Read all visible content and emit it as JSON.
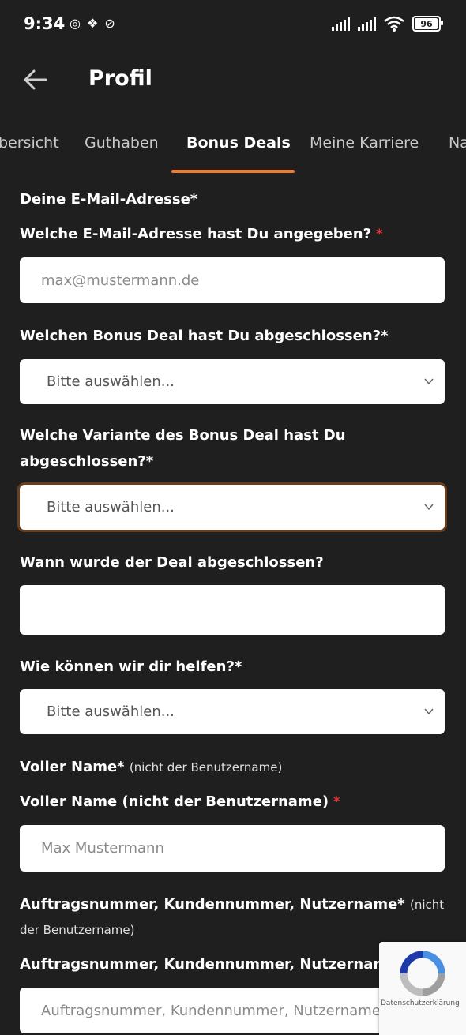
{
  "status": {
    "time": "9:34",
    "battery": "96"
  },
  "header": {
    "title": "Profil"
  },
  "tabs": [
    {
      "label": "bersicht"
    },
    {
      "label": "Guthaben"
    },
    {
      "label": "Bonus Deals"
    },
    {
      "label": "Meine Karriere"
    },
    {
      "label": "Na"
    }
  ],
  "form": {
    "email_section": "Deine E-Mail-Adresse*",
    "email_label": "Welche E-Mail-Adresse hast Du angegeben?",
    "email_placeholder": "max@mustermann.de",
    "deal_label": "Welchen Bonus Deal hast Du abgeschlossen?*",
    "deal_value": "Bitte auswählen...",
    "variant_label_1": "Welche Variante des Bonus Deal hast Du",
    "variant_label_2": "abgeschlossen?*",
    "variant_value": "Bitte auswählen...",
    "date_label": "Wann wurde der Deal abgeschlossen?",
    "date_value": "",
    "help_label": "Wie können wir dir helfen?*",
    "help_value": "Bitte auswählen...",
    "name_section": "Voller Name*",
    "name_section_note": "(nicht der Benutzername)",
    "name_label": "Voller Name (nicht der Benutzername)",
    "name_placeholder": "Max Mustermann",
    "order_section": "Auftragsnummer, Kundennummer, Nutzername*",
    "order_section_note_1": "(nicht",
    "order_section_note_2": "der Benutzername)",
    "order_label": "Auftragsnummer, Kundennummer, Nutzernam",
    "order_placeholder": "Auftragsnummer, Kundennummer, Nutzername"
  },
  "recaptcha": {
    "text": "Datenschutzerklärung"
  }
}
